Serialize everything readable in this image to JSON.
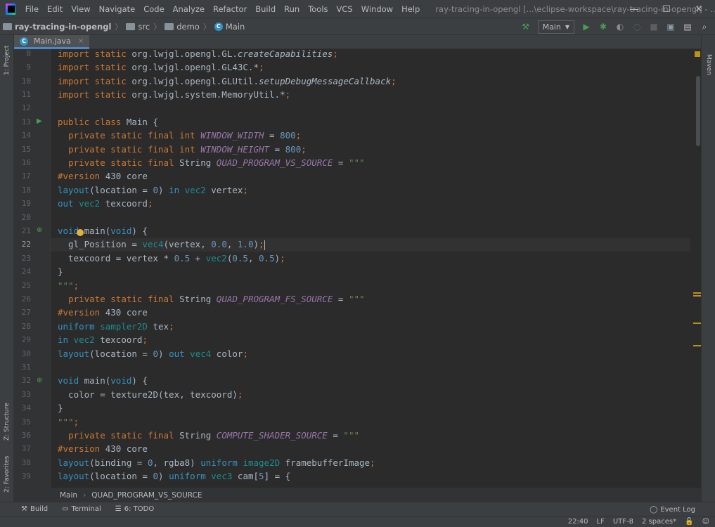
{
  "colors": {
    "accent": "#4a88c7",
    "keyword": "#cc7832",
    "constant": "#9876aa",
    "number": "#6897bb",
    "string": "#6a8759",
    "run_green": "#499c54"
  },
  "menu": [
    "File",
    "Edit",
    "View",
    "Navigate",
    "Code",
    "Analyze",
    "Refactor",
    "Build",
    "Run",
    "Tools",
    "VCS",
    "Window",
    "Help"
  ],
  "window_title": "ray-tracing-in-opengl [...\\eclipse-workspace\\ray-tracing-in-opengl] - ...\\Main.java",
  "window_controls": {
    "minimize": "—",
    "maximize": "☐",
    "close": "✕"
  },
  "nav": {
    "project": "ray-tracing-in-opengl",
    "crumbs": [
      "src",
      "demo",
      "Main"
    ]
  },
  "run_config": {
    "label": "Main"
  },
  "tab": {
    "label": "Main.java",
    "close": "×"
  },
  "side_tabs": {
    "project": "1: Project",
    "structure": "Z: Structure",
    "favorites": "2: Favorites",
    "maven": "Maven"
  },
  "line_numbers": [
    "8",
    "9",
    "10",
    "11",
    "12",
    "13",
    "14",
    "15",
    "16",
    "17",
    "18",
    "19",
    "20",
    "21",
    "22",
    "23",
    "24",
    "25",
    "26",
    "27",
    "28",
    "29",
    "30",
    "31",
    "32",
    "33",
    "34",
    "35",
    "36",
    "37",
    "38",
    "39"
  ],
  "current_line": "22",
  "breadcrumb": {
    "class": "Main",
    "field": "QUAD_PROGRAM_VS_SOURCE"
  },
  "tool_windows": {
    "build": "Build",
    "terminal": "Terminal",
    "todo": "6: TODO",
    "event_log": "Event Log"
  },
  "status": {
    "position": "22:40",
    "line_sep": "LF",
    "encoding": "UTF-8",
    "indent": "2 spaces*"
  }
}
